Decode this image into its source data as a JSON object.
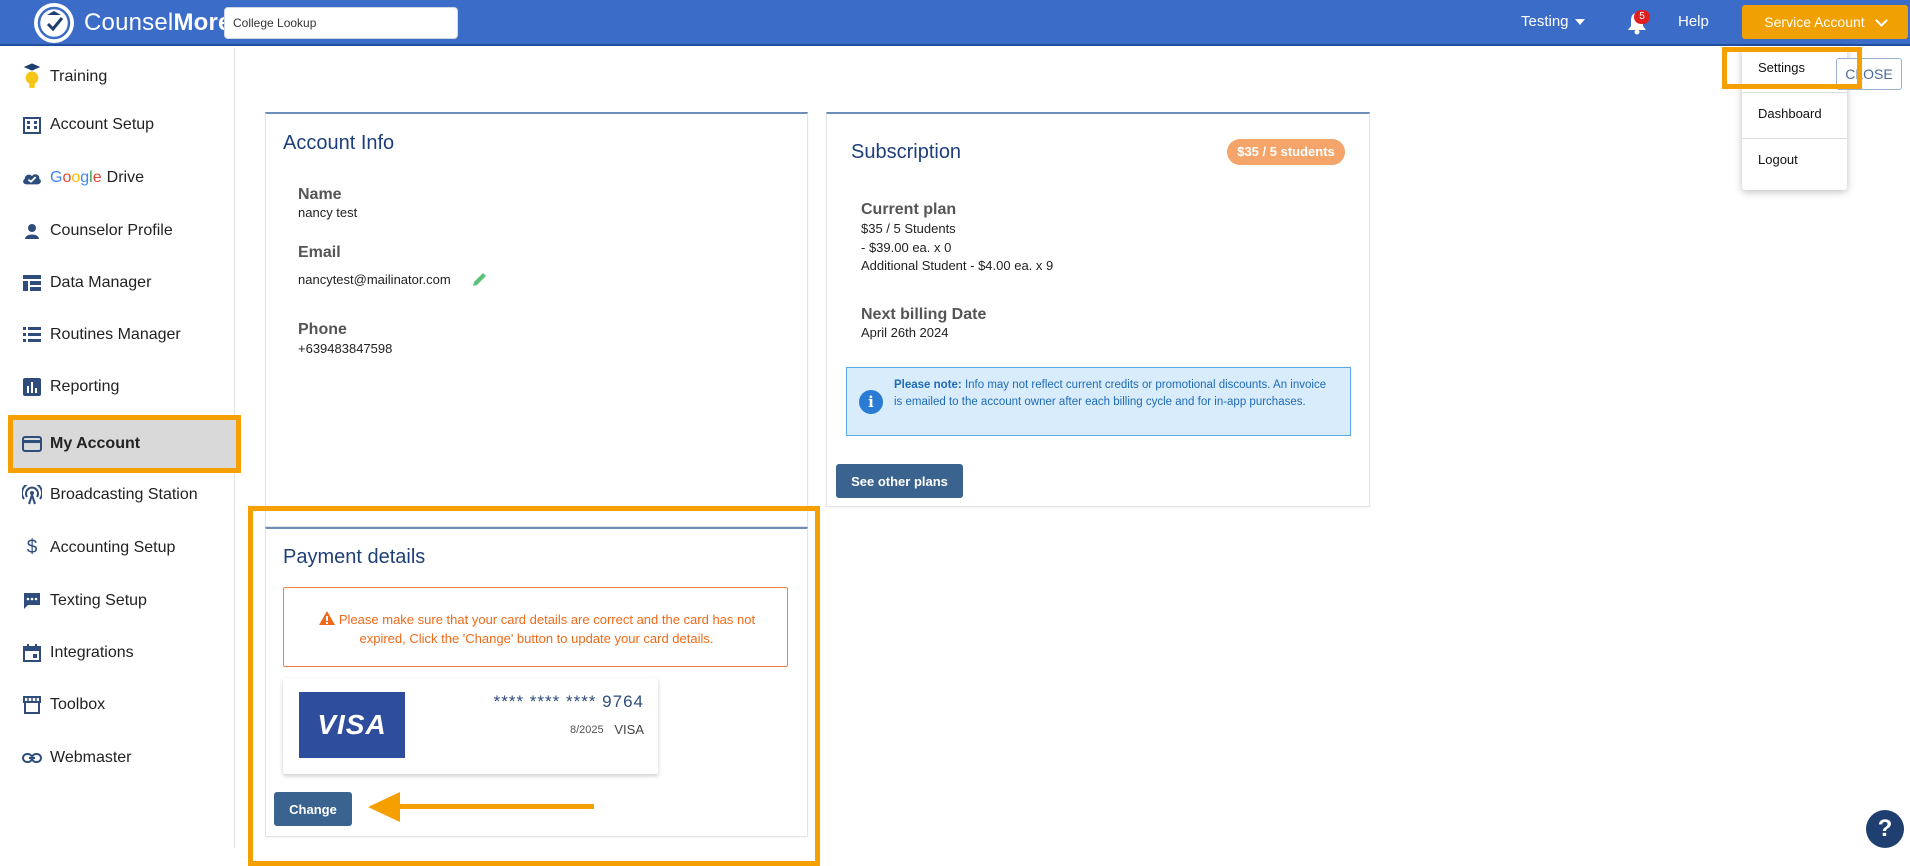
{
  "header": {
    "brand_light": "Counsel",
    "brand_bold": "More",
    "search_value": "College Lookup",
    "testing_label": "Testing",
    "notification_count": "5",
    "help_label": "Help",
    "account_label": "Service Account"
  },
  "dropdown": {
    "items": [
      "Settings",
      "Dashboard",
      "Logout"
    ]
  },
  "close_label": "CLOSE",
  "sidebar": {
    "items": [
      {
        "label": "Training",
        "icon": "lightbulb-icon"
      },
      {
        "label": "Account Setup",
        "icon": "building-icon"
      },
      {
        "label": "Drive",
        "icon": "cloud-check-icon",
        "prefix": "Google"
      },
      {
        "label": "Counselor Profile",
        "icon": "person-icon"
      },
      {
        "label": "Data Manager",
        "icon": "table-icon"
      },
      {
        "label": "Routines Manager",
        "icon": "list-icon"
      },
      {
        "label": "Reporting",
        "icon": "bar-chart-icon"
      },
      {
        "label": "My Account",
        "icon": "credit-card-icon"
      },
      {
        "label": "Broadcasting Station",
        "icon": "broadcast-icon"
      },
      {
        "label": "Accounting Setup",
        "icon": "dollar-icon"
      },
      {
        "label": "Texting Setup",
        "icon": "chat-icon"
      },
      {
        "label": "Integrations",
        "icon": "calendar-icon"
      },
      {
        "label": "Toolbox",
        "icon": "store-icon"
      },
      {
        "label": "Webmaster",
        "icon": "link-icon"
      }
    ]
  },
  "account_info": {
    "title": "Account Info",
    "name_label": "Name",
    "name_value": "nancy test",
    "email_label": "Email",
    "email_value": "nancytest@mailinator.com",
    "phone_label": "Phone",
    "phone_value": "+639483847598"
  },
  "subscription": {
    "title": "Subscription",
    "badge": "$35 / 5 students",
    "current_plan_label": "Current plan",
    "plan_line1": "$35 / 5 Students",
    "plan_line2": "- $39.00 ea. x 0",
    "plan_line3": "Additional Student - $4.00 ea. x 9",
    "next_billing_label": "Next billing Date",
    "next_billing_value": "April 26th 2024",
    "note_bold": "Please note:",
    "note_text": " Info may not reflect current credits or promotional discounts. An invoice is emailed to the account owner after each billing cycle and for in-app purchases.",
    "other_plans_label": "See other plans"
  },
  "payment": {
    "title": "Payment details",
    "warning": "Please make sure that your card details are correct and the card has not expired, Click the 'Change' button to update your card details.",
    "card_logo": "VISA",
    "card_number": "**** **** **** 9764",
    "card_expiry": "8/2025",
    "card_brand": "VISA",
    "change_label": "Change"
  },
  "help_fab": "?",
  "colors": {
    "topbar": "#3b6cc7",
    "accent": "#f0a000",
    "highlight": "#f5a000",
    "primary_button": "#3b6390"
  }
}
